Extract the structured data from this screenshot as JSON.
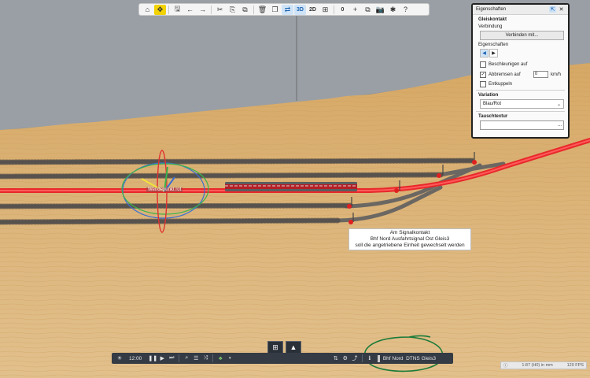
{
  "toolbar": {
    "buttons": [
      {
        "name": "home-button",
        "glyph": "⌂"
      },
      {
        "name": "select-tool-button",
        "glyph": "✥",
        "active": true
      },
      {
        "sep": true
      },
      {
        "name": "save-button",
        "glyph": "🖫"
      },
      {
        "name": "undo-button",
        "glyph": "←"
      },
      {
        "name": "redo-button",
        "glyph": "→"
      },
      {
        "sep": true
      },
      {
        "name": "cut-button",
        "glyph": "✂"
      },
      {
        "name": "copy-button",
        "glyph": "⎘"
      },
      {
        "name": "paste-button",
        "glyph": "⧉"
      },
      {
        "sep": true
      },
      {
        "name": "delete-button",
        "glyph": "🗑"
      },
      {
        "name": "duplicate-button",
        "glyph": "❐"
      },
      {
        "name": "snap-button",
        "glyph": "⇄",
        "active_blue": true
      },
      {
        "name": "view-3d-button",
        "text": "3D",
        "active_blue": true
      },
      {
        "name": "view-2d-button",
        "text": "2D"
      },
      {
        "name": "grid-button",
        "glyph": "⊞"
      },
      {
        "sep": true
      },
      {
        "name": "layer-count",
        "text": "0"
      },
      {
        "name": "add-layer-button",
        "glyph": "+"
      },
      {
        "name": "clone-button",
        "glyph": "⧉"
      },
      {
        "name": "screenshot-button",
        "glyph": "📷"
      },
      {
        "name": "settings-button",
        "glyph": "✱"
      },
      {
        "name": "help-button",
        "glyph": "?"
      }
    ]
  },
  "properties": {
    "title": "Eigenschaften",
    "section_contact": "Gleiskontakt",
    "connection_label": "Verbindung",
    "connect_button": "Verbinden mit...",
    "properties_label": "Eigenschaften",
    "accelerate_label": "Beschleunigen auf",
    "accelerate_checked": false,
    "brake_label": "Abbremsen auf",
    "brake_checked": true,
    "brake_speed": "0",
    "speed_unit": "km/h",
    "uncouple_label": "Entkuppeln",
    "uncouple_checked": false,
    "variation_label": "Variation",
    "variation_value": "Blau/Rot",
    "texture_label": "Tauschtextur",
    "texture_button": "..."
  },
  "annotation": {
    "line1": "Am Signalkontakt",
    "line2": "Bhf Nord Ausfahrtsignal Ost Gleis3",
    "line3": "soll die angetriebene Einheit gewechselt werden"
  },
  "gizmo_label": "Wendepunkt rot",
  "bottom_bar": {
    "time": "12:00",
    "selected_unit": "Bhf Nord  DTNS Gleis3"
  },
  "status": {
    "scale": "1:87 (H0) in mm",
    "fps": "120 FPS"
  },
  "colors": {
    "sky": "#8a8f96",
    "table": "#d8ad6e",
    "track_highlight": "#e8282a",
    "annotation_green": "#1a7a3a"
  }
}
